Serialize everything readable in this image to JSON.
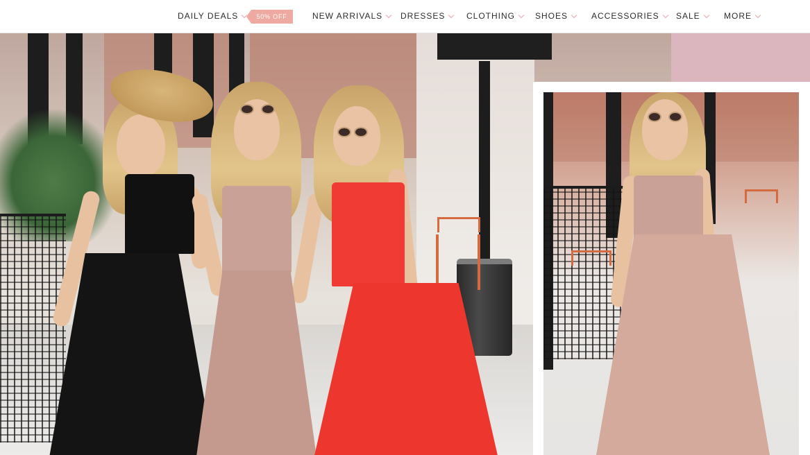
{
  "nav": {
    "items": [
      {
        "label": "DAILY DEALS",
        "has_dropdown": true
      },
      {
        "label": "NEW ARRIVALS",
        "has_dropdown": true
      },
      {
        "label": "DRESSES",
        "has_dropdown": true
      },
      {
        "label": "CLOTHING",
        "has_dropdown": true
      },
      {
        "label": "SHOES",
        "has_dropdown": true
      },
      {
        "label": "ACCESSORIES",
        "has_dropdown": true
      },
      {
        "label": "SALE",
        "has_dropdown": true
      },
      {
        "label": "MORE",
        "has_dropdown": true
      }
    ],
    "promo_badge": "50% OFF"
  },
  "colors": {
    "accent_pink": "#dbb6bf",
    "badge_pink": "#eea9a3",
    "chevron": "#e7a6a6",
    "dress_black": "#111111",
    "dress_mauve": "#c9a197",
    "dress_red": "#ef3b33"
  },
  "hero": {
    "main_image": "three-women-in-maxi-dresses-walking-photo",
    "side_image": "woman-in-mauve-pleated-maxi-dress-photo"
  }
}
